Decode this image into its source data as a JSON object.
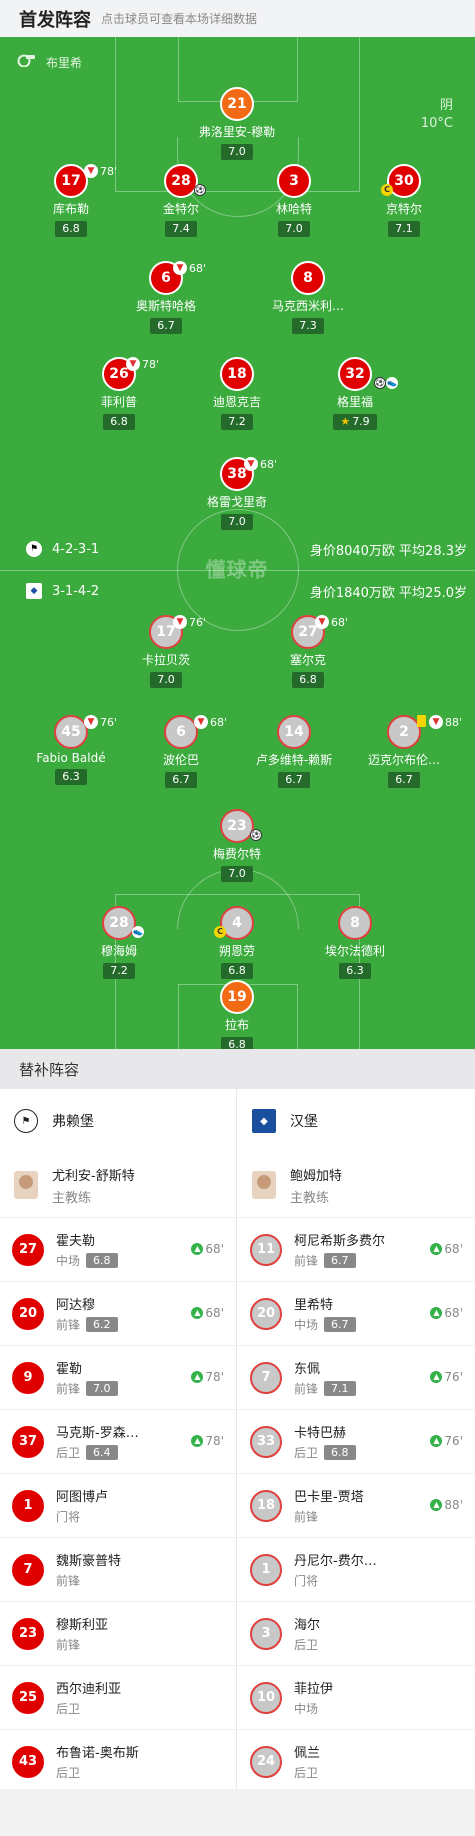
{
  "header": {
    "title": "首发阵容",
    "hint": "点击球员可查看本场详细数据"
  },
  "pitch": {
    "referee": "布里希",
    "weather": {
      "condition": "阴",
      "temperature": "10°C"
    },
    "watermark": "懂球帝",
    "home": {
      "formation": "4-2-3-1",
      "summary": "身价8040万欧 平均28.3岁"
    },
    "away": {
      "formation": "3-1-4-2",
      "summary": "身价1840万欧 平均25.0岁"
    },
    "home_players": [
      {
        "num": "21",
        "name": "弗洛里安-穆勒",
        "rating": "7.0"
      },
      {
        "num": "17",
        "name": "库布勒",
        "rating": "6.8",
        "sub": "78'"
      },
      {
        "num": "28",
        "name": "金特尔",
        "rating": "7.4"
      },
      {
        "num": "3",
        "name": "林哈特",
        "rating": "7.0"
      },
      {
        "num": "30",
        "name": "京特尔",
        "rating": "7.1"
      },
      {
        "num": "6",
        "name": "奥斯特哈格",
        "rating": "6.7",
        "sub": "68'"
      },
      {
        "num": "8",
        "name": "马克西米利…",
        "rating": "7.3"
      },
      {
        "num": "26",
        "name": "菲利普",
        "rating": "6.8",
        "sub": "78'"
      },
      {
        "num": "18",
        "name": "迪恩克吉",
        "rating": "7.2"
      },
      {
        "num": "32",
        "name": "格里福",
        "rating": "7.9"
      },
      {
        "num": "38",
        "name": "格雷戈里奇",
        "rating": "7.0",
        "sub": "68'"
      }
    ],
    "away_players": [
      {
        "num": "17",
        "name": "卡拉贝茨",
        "rating": "7.0",
        "sub": "76'"
      },
      {
        "num": "27",
        "name": "塞尔克",
        "rating": "6.8",
        "sub": "68'"
      },
      {
        "num": "45",
        "name": "Fabio Baldé",
        "rating": "6.3",
        "sub": "76'"
      },
      {
        "num": "6",
        "name": "波伦巴",
        "rating": "6.7",
        "sub": "68'"
      },
      {
        "num": "14",
        "name": "卢多维特-赖斯",
        "rating": "6.7"
      },
      {
        "num": "2",
        "name": "迈克尔布伦…",
        "rating": "6.7",
        "sub": "88'"
      },
      {
        "num": "23",
        "name": "梅费尔特",
        "rating": "7.0"
      },
      {
        "num": "28",
        "name": "穆海姆",
        "rating": "7.2"
      },
      {
        "num": "4",
        "name": "朔恩劳",
        "rating": "6.8"
      },
      {
        "num": "8",
        "name": "埃尔法德利",
        "rating": "6.3"
      },
      {
        "num": "19",
        "name": "拉布",
        "rating": "6.8"
      }
    ]
  },
  "subs": {
    "title": "替补阵容",
    "home": {
      "club": "弗赖堡",
      "coach": {
        "name": "尤利安-舒斯特",
        "role": "主教练"
      },
      "players": [
        {
          "num": "27",
          "name": "霍夫勒",
          "pos": "中场",
          "rating": "6.8",
          "in": "68'"
        },
        {
          "num": "20",
          "name": "阿达穆",
          "pos": "前锋",
          "rating": "6.2",
          "in": "68'"
        },
        {
          "num": "9",
          "name": "霍勒",
          "pos": "前锋",
          "rating": "7.0",
          "in": "78'"
        },
        {
          "num": "37",
          "name": "马克斯-罗森…",
          "pos": "后卫",
          "rating": "6.4",
          "in": "78'"
        },
        {
          "num": "1",
          "name": "阿图博卢",
          "pos": "门将"
        },
        {
          "num": "7",
          "name": "魏斯豪普特",
          "pos": "前锋"
        },
        {
          "num": "23",
          "name": "穆斯利亚",
          "pos": "前锋"
        },
        {
          "num": "25",
          "name": "西尔迪利亚",
          "pos": "后卫"
        },
        {
          "num": "43",
          "name": "布鲁诺-奥布斯",
          "pos": "后卫"
        }
      ]
    },
    "away": {
      "club": "汉堡",
      "coach": {
        "name": "鲍姆加特",
        "role": "主教练"
      },
      "players": [
        {
          "num": "11",
          "name": "柯尼希斯多费尔",
          "pos": "前锋",
          "rating": "6.7",
          "in": "68'"
        },
        {
          "num": "20",
          "name": "里希特",
          "pos": "中场",
          "rating": "6.7",
          "in": "68'"
        },
        {
          "num": "7",
          "name": "东佩",
          "pos": "前锋",
          "rating": "7.1",
          "in": "76'"
        },
        {
          "num": "33",
          "name": "卡特巴赫",
          "pos": "后卫",
          "rating": "6.8",
          "in": "76'"
        },
        {
          "num": "18",
          "name": "巴卡里-贾塔",
          "pos": "前锋",
          "in": "88'"
        },
        {
          "num": "1",
          "name": "丹尼尔-费尔…",
          "pos": "门将"
        },
        {
          "num": "3",
          "name": "海尔",
          "pos": "后卫"
        },
        {
          "num": "10",
          "name": "菲拉伊",
          "pos": "中场"
        },
        {
          "num": "24",
          "name": "佩兰",
          "pos": "后卫"
        }
      ]
    }
  }
}
